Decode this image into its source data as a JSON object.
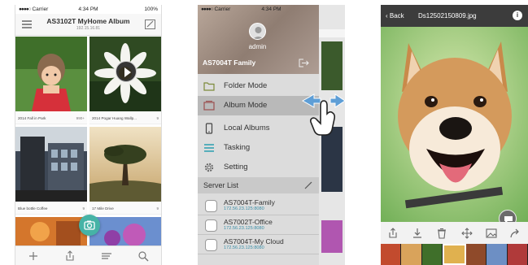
{
  "status_bar": {
    "carrier": "Carrier",
    "time": "4:34 PM",
    "battery": "100%"
  },
  "album_screen": {
    "title": "AS3102T MyHome Album",
    "ip": "192.15.16.81",
    "tiles": [
      {
        "caption": "2014 Fall in Park",
        "count": "990+"
      },
      {
        "caption": "2014 Pogar Huang Wallp...",
        "count": "9"
      },
      {
        "caption": "Blue bottle Coffee",
        "count": "9"
      },
      {
        "caption": "17 Mile Drive",
        "count": "9"
      }
    ],
    "toolbar_icons": [
      "plus-icon",
      "share-icon",
      "sort-icon",
      "search-icon"
    ]
  },
  "drawer_screen": {
    "user": "admin",
    "nas_name": "AS7004T Family",
    "menu": [
      {
        "label": "Folder Mode",
        "icon": "folder-icon"
      },
      {
        "label": "Album Mode",
        "icon": "album-icon",
        "selected": true
      },
      {
        "label": "Local Albums",
        "icon": "phone-icon"
      },
      {
        "label": "Tasking",
        "icon": "list-icon"
      },
      {
        "label": "Setting",
        "icon": "gear-icon"
      }
    ],
    "server_list_label": "Server List",
    "servers": [
      {
        "name": "AS7004T-Family",
        "ip": "172.56.23.125:8080"
      },
      {
        "name": "AS7002T-Office",
        "ip": "172.56.23.125:8080"
      },
      {
        "name": "AS7004T-My Cloud",
        "ip": "172.56.23.125:8080"
      }
    ]
  },
  "photo_screen": {
    "back_label": "Back",
    "filename": "Ds12502150809.jpg",
    "info_label": "i",
    "toolbar_icons": [
      "share-icon",
      "download-icon",
      "trash-icon",
      "move-icon",
      "image-icon",
      "forward-icon"
    ]
  },
  "colors": {
    "accent_teal": "#46b3a6",
    "server_ip_blue": "#3b8fa8"
  }
}
